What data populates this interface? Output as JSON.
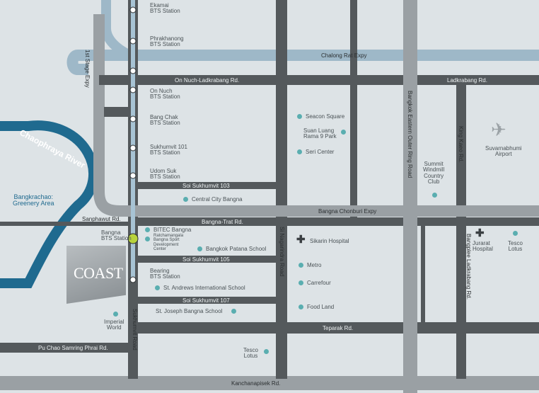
{
  "map": {
    "colors": {
      "background": "#dde3e6",
      "expressway": "#9eb8c8",
      "main_road": "#54595c",
      "ring_road": "#9aa0a4",
      "river": "#1f6a8f",
      "bts_line": "#a7c3d4",
      "poi": "#5aaeb0",
      "bts_current_station": "#b8d33c"
    },
    "stations": {
      "ekamai": "Ekamai\nBTS Station",
      "phrakhanong": "Phrakhanong\nBTS Station",
      "on_nuch": "On Nuch\nBTS Station",
      "bang_chak": "Bang Chak\nBTS Station",
      "sukhumvit_101": "Sukhumvit 101\nBTS Station",
      "udom_suk": "Udom Suk\nBTS Station",
      "bangna": "Bangna\nBTS Station",
      "bearing": "Bearing\nBTS Station"
    },
    "roads": {
      "chalong_rat": "Chalong Rat Expy",
      "on_nuch_ladkrabang": "On Nuch-Ladkrabang Rd.",
      "ladkrabang": "Ladkrabang Rd.",
      "first_stage_expy": "1st Stage Expy",
      "bangkok_outer_ring": "Bangkok Eastern Outer Ring Road",
      "king_kaeo": "King Kaeo Rd.",
      "soi_103": "Soi Sukhumvit 103",
      "bangna_chonburi": "Bangna Chonburi Expy",
      "sanphawut": "Sanphawut Rd.",
      "bangna_trat": "Bangna-Trat Rd.",
      "soi_105": "Soi Sukhumvit 105",
      "soi_107": "Soi Sukhumvit 107",
      "si_nagarindra": "Si Nagarindra Road",
      "bangplee_ladkrabang": "Bangplee Ladkrabang Rd.",
      "sukhumvit": "Sukhumvit Road",
      "teparak": "Teparak Rd.",
      "pu_chao": "Pu Chao Samring Phrai Rd.",
      "kanchanapisek": "Kanchanapisek Rd."
    },
    "places": {
      "seacon_square": "Seacon Square",
      "suan_luang": "Suan Luang\nRama 9 Park",
      "seri_center": "Seri Center",
      "central_city": "Central City Bangna",
      "bitec": "BITEC Bangna",
      "ratchamangala": "Ratchamangala\nBangna Sport\nDevelopment\nCenter",
      "bangkok_patana": "Bangkok Patana School",
      "st_andrews": "St. Andrews International School",
      "st_joseph": "St. Joseph Bangna School",
      "imperial_world": "Imperial\nWorld",
      "tesco_lotus_south": "Tesco\nLotus",
      "samitivej_hospital": "Sikarin Hospital",
      "metro": "Metro",
      "carrefour": "Carrefour",
      "food_land": "Food Land",
      "summit_windmill": "Summit\nWindmill\nCountry\nClub",
      "suvarnabhumi": "Suvarnabhumi\nAirport",
      "jurarat_hospital": "Jurarat\nHospital",
      "tesco_lotus_east": "Tesco\nLotus",
      "chaophraya_river": "Chaophraya River",
      "bangkrachao": "Bangkrachao:\nGreenery Area"
    },
    "logo_text": "COAST",
    "icons": {
      "hospital": "hospital-cross-icon",
      "airport": "airplane-icon",
      "poi": "poi-dot-icon",
      "station": "bts-station-icon"
    }
  }
}
